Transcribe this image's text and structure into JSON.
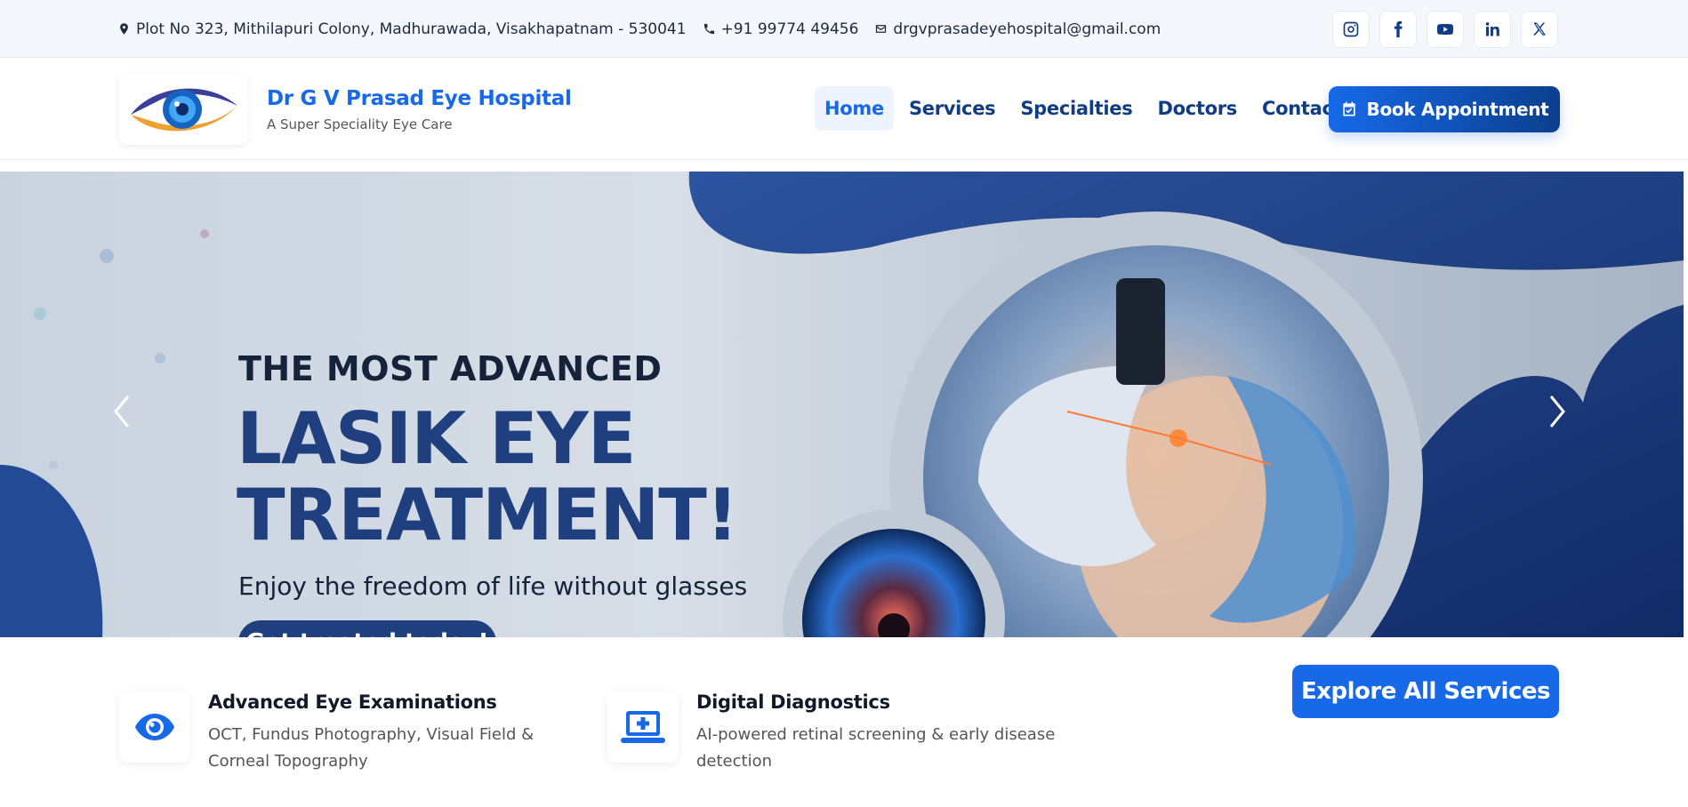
{
  "topbar": {
    "address": "Plot No 323, Mithilapuri Colony, Madhurawada, Visakhapatnam - 530041",
    "phone": "+91 99774 49456",
    "email": "drgvprasadeyehospital@gmail.com",
    "socials": [
      "instagram-icon",
      "facebook-icon",
      "youtube-icon",
      "linkedin-icon",
      "x-icon"
    ]
  },
  "brand": {
    "title": "Dr G V Prasad Eye Hospital",
    "subtitle": "A Super Speciality Eye Care"
  },
  "nav": {
    "items": [
      {
        "label": "Home",
        "active": true
      },
      {
        "label": "Services",
        "active": false
      },
      {
        "label": "Specialties",
        "active": false
      },
      {
        "label": "Doctors",
        "active": false
      },
      {
        "label": "Contact Us",
        "active": false
      }
    ],
    "book_label": "Book Appointment"
  },
  "hero": {
    "pretitle": "THE MOST ADVANCED",
    "title_line1": "LASIK EYE",
    "title_line2": "TREATMENT!",
    "subtitle": "Enjoy the freedom of life without glasses",
    "cta": "Get treated today!"
  },
  "features": [
    {
      "title": "Advanced Eye Examinations",
      "desc": "OCT, Fundus Photography, Visual Field & Corneal Topography",
      "icon": "eye-icon"
    },
    {
      "title": "Digital Diagnostics",
      "desc": "AI-powered retinal screening & early disease detection",
      "icon": "laptop-medical-icon"
    }
  ],
  "explore_label": "Explore All Services",
  "colors": {
    "primary": "#1769e8",
    "navy": "#0f3c84",
    "hero_navy": "#1f3f7e",
    "eye_orange": "#f0a030"
  }
}
